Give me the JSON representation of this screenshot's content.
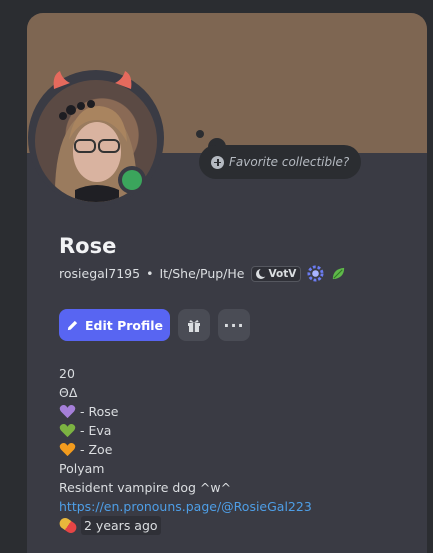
{
  "profile": {
    "display_name": "Rose",
    "username": "rosiegal7195",
    "separator": "•",
    "pronouns": "It/She/Pup/He",
    "server_tag": "VotV",
    "collectible_placeholder": "Favorite collectible?",
    "status": "online"
  },
  "actions": {
    "edit_profile_label": "Edit Profile",
    "more_label": "···"
  },
  "bio": {
    "age": "20",
    "symbols": "ΘΔ",
    "members": [
      {
        "label": "- Rose",
        "heart_color": "#a57fd9"
      },
      {
        "label": "- Eva",
        "heart_color": "#7cb342"
      },
      {
        "label": "- Zoe",
        "heart_color": "#f39c1e"
      }
    ],
    "line_polyam": "Polyam",
    "line_tagline": "Resident vampire dog ^w^",
    "link": "https://en.pronouns.page/@RosieGal223",
    "member_since": "2 years ago"
  },
  "colors": {
    "banner": "#7e6652",
    "accent": "#5865f2",
    "status_online": "#3ba55c",
    "link": "#4e9ee6"
  },
  "icons": [
    "plus-circle-icon",
    "moon-icon",
    "hypesquad-badge-icon",
    "leaf-badge-icon",
    "pencil-icon",
    "gift-icon",
    "more-icon",
    "heart-icon",
    "pill-icon"
  ]
}
